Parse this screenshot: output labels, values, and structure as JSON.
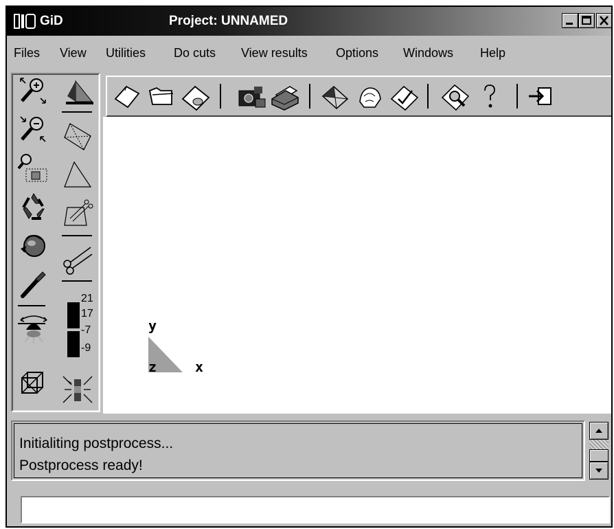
{
  "titlebar": {
    "app_name": "GiD",
    "title": "Project: UNNAMED"
  },
  "menubar": {
    "items": [
      "Files",
      "View",
      "Utilities",
      "Do cuts",
      "View results",
      "Options",
      "Windows",
      "Help"
    ]
  },
  "left_toolbar": {
    "icons": [
      "zoom-in-icon",
      "zoom-out-icon",
      "zoom-frame-icon",
      "redraw-icon",
      "rotate-icon",
      "pan-icon",
      "light-icon",
      "render-box-icon",
      "render-solid-icon",
      "render-wireframe-icon",
      "render-flat-icon",
      "cut-plane-icon",
      "scissors-icon",
      "contour-legend-icon",
      "vector-icon"
    ],
    "legend_values": [
      "21",
      "17",
      "-7",
      "-9"
    ]
  },
  "top_toolbar": {
    "icons": [
      "new-icon",
      "open-icon",
      "save-icon",
      "snapshot-icon",
      "print-icon",
      "preprocess-icon",
      "postprocess-icon",
      "check-icon",
      "view-icon",
      "help-icon",
      "exit-icon"
    ]
  },
  "canvas": {
    "axes": {
      "x_label": "x",
      "y_label": "y",
      "z_label": "z"
    }
  },
  "messages": {
    "lines": [
      "Initialiting postprocess...",
      "Postprocess ready!"
    ]
  },
  "command": {
    "value": ""
  },
  "colors": {
    "face": "#c0c0c0",
    "canvas": "#ffffff",
    "axis_triangle": "#a0a0a0"
  }
}
